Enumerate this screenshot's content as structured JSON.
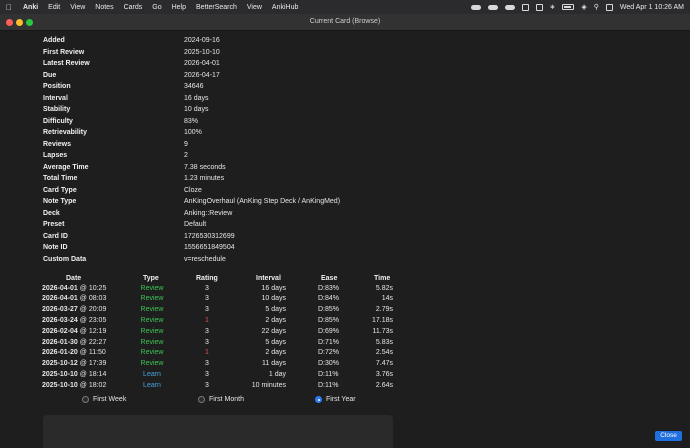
{
  "menubar": {
    "app": "Anki",
    "items": [
      "Edit",
      "View",
      "Notes",
      "Cards",
      "Go",
      "Help",
      "BetterSearch",
      "View",
      "AnkiHub"
    ],
    "datetime": "Wed Apr 1  10:26 AM"
  },
  "window": {
    "title": "Current Card (Browse)"
  },
  "card_info": [
    {
      "label": "Added",
      "value": "2024-09-16"
    },
    {
      "label": "First Review",
      "value": "2025-10-10"
    },
    {
      "label": "Latest Review",
      "value": "2026-04-01"
    },
    {
      "label": "Due",
      "value": "2026-04-17"
    },
    {
      "label": "Position",
      "value": "34646"
    },
    {
      "label": "Interval",
      "value": "16 days"
    },
    {
      "label": "Stability",
      "value": "10 days"
    },
    {
      "label": "Difficulty",
      "value": "83%"
    },
    {
      "label": "Retrievability",
      "value": "100%"
    },
    {
      "label": "Reviews",
      "value": "9"
    },
    {
      "label": "Lapses",
      "value": "2"
    },
    {
      "label": "Average Time",
      "value": "7.38 seconds"
    },
    {
      "label": "Total Time",
      "value": "1.23 minutes"
    },
    {
      "label": "Card Type",
      "value": "Cloze"
    },
    {
      "label": "Note Type",
      "value": "AnKingOverhaul (AnKing Step Deck / AnKingMed)"
    },
    {
      "label": "Deck",
      "value": "Anking::Review"
    },
    {
      "label": "Preset",
      "value": "Default"
    },
    {
      "label": "Card ID",
      "value": "1726530312699"
    },
    {
      "label": "Note ID",
      "value": "1556651849504"
    },
    {
      "label": "Custom Data",
      "value": "v=reschedule"
    }
  ],
  "reviews": {
    "headers": {
      "date": "Date",
      "type": "Type",
      "rating": "Rating",
      "interval": "Interval",
      "ease": "Ease",
      "time": "Time"
    },
    "rows": [
      {
        "date": "2026-04-01",
        "clock": "@ 10:25",
        "type": "Review",
        "rating": "3",
        "interval": "16 days",
        "ease": "D:83%",
        "time": "5.82s"
      },
      {
        "date": "2026-04-01",
        "clock": "@ 08:03",
        "type": "Review",
        "rating": "3",
        "interval": "10 days",
        "ease": "D:84%",
        "time": "14s"
      },
      {
        "date": "2026-03-27",
        "clock": "@ 20:09",
        "type": "Review",
        "rating": "3",
        "interval": "5 days",
        "ease": "D:85%",
        "time": "2.79s"
      },
      {
        "date": "2026-03-24",
        "clock": "@ 23:05",
        "type": "Review",
        "rating": "1",
        "interval": "2 days",
        "ease": "D:85%",
        "time": "17.18s"
      },
      {
        "date": "2026-02-04",
        "clock": "@ 12:19",
        "type": "Review",
        "rating": "3",
        "interval": "22 days",
        "ease": "D:69%",
        "time": "11.73s"
      },
      {
        "date": "2026-01-30",
        "clock": "@ 22:27",
        "type": "Review",
        "rating": "3",
        "interval": "5 days",
        "ease": "D:71%",
        "time": "5.83s"
      },
      {
        "date": "2026-01-20",
        "clock": "@ 11:50",
        "type": "Review",
        "rating": "1",
        "interval": "2 days",
        "ease": "D:72%",
        "time": "2.54s"
      },
      {
        "date": "2025-10-12",
        "clock": "@ 17:39",
        "type": "Review",
        "rating": "3",
        "interval": "11 days",
        "ease": "D:30%",
        "time": "7.47s"
      },
      {
        "date": "2025-10-10",
        "clock": "@ 18:14",
        "type": "Learn",
        "rating": "3",
        "interval": "1 day",
        "ease": "D:11%",
        "time": "3.76s"
      },
      {
        "date": "2025-10-10",
        "clock": "@ 18:02",
        "type": "Learn",
        "rating": "3",
        "interval": "10 minutes",
        "ease": "D:11%",
        "time": "2.64s"
      }
    ]
  },
  "range_options": [
    {
      "label": "First Week",
      "selected": false
    },
    {
      "label": "First Month",
      "selected": false
    },
    {
      "label": "First Year",
      "selected": true
    }
  ],
  "buttons": {
    "close": "Close"
  },
  "colors": {
    "review": "#3cc256",
    "learn": "#4aa3e0",
    "again": "#e05252",
    "accent": "#1f6fe0"
  }
}
